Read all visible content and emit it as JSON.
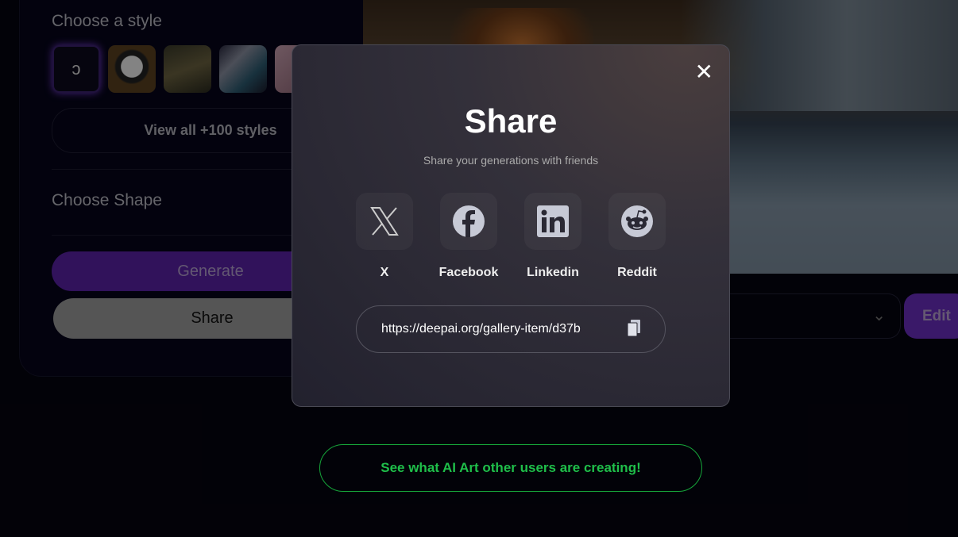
{
  "sidebar": {
    "style_heading": "Choose a style",
    "styles": [
      "default-style",
      "panda",
      "forest",
      "cyberpunk-robot",
      "portrait"
    ],
    "view_all_label": "View all +100 styles",
    "shape_heading": "Choose Shape",
    "generate_label": "Generate",
    "share_label": "Share"
  },
  "toolbar": {
    "edit_label": "Edit"
  },
  "footer": {
    "gallery_link": "See what AI Art other users are creating!"
  },
  "share_modal": {
    "title": "Share",
    "subtitle": "Share your generations with friends",
    "networks": [
      {
        "label": "X",
        "icon": "x-icon"
      },
      {
        "label": "Facebook",
        "icon": "facebook-icon"
      },
      {
        "label": "Linkedin",
        "icon": "linkedin-icon"
      },
      {
        "label": "Reddit",
        "icon": "reddit-icon"
      }
    ],
    "link_value": "https://deepai.org/gallery-item/d37b"
  },
  "colors": {
    "accent": "#6a2fc9",
    "link_green": "#1fbf4a",
    "background": "#05040f"
  }
}
